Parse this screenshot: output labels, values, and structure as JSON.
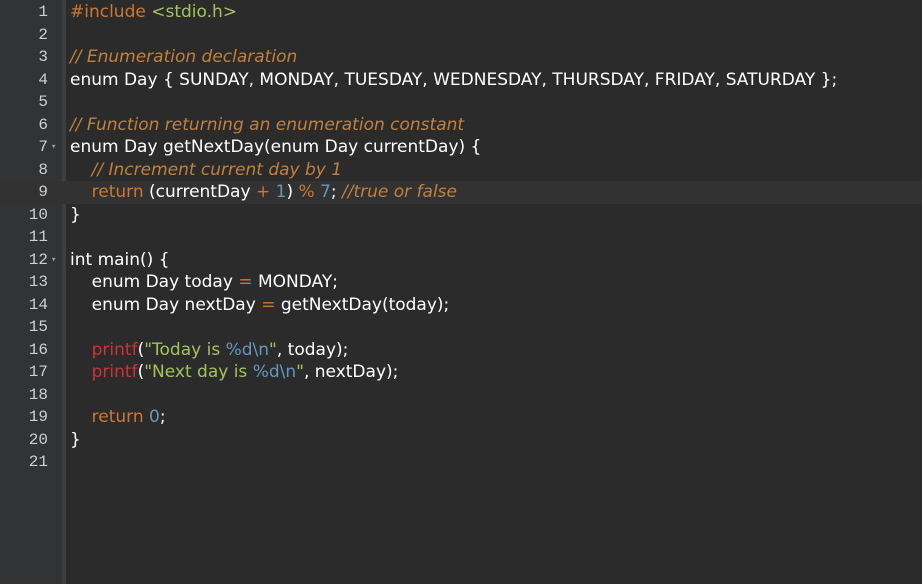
{
  "editor": {
    "language": "c",
    "active_line": 9,
    "colors": {
      "background": "#2b2b2b",
      "gutter": "#313335",
      "keyword": "#cc7832",
      "string": "#a5c25c",
      "comment": "#c0813f",
      "number": "#6897bb",
      "function_call": "#cc3333"
    },
    "line_numbers": [
      "1",
      "2",
      "3",
      "4",
      "5",
      "6",
      "7",
      "8",
      "9",
      "10",
      "11",
      "12",
      "13",
      "14",
      "15",
      "16",
      "17",
      "18",
      "19",
      "20",
      "21"
    ],
    "lines": [
      [
        {
          "t": "#include ",
          "c": "pp"
        },
        {
          "t": "<stdio.h>",
          "c": "inc"
        }
      ],
      [],
      [
        {
          "t": "// Enumeration declaration",
          "c": "cm"
        }
      ],
      [
        {
          "t": "enum Day { SUNDAY, MONDAY, TUESDAY, WEDNESDAY, THURSDAY, FRIDAY, SATURDAY };",
          "c": "pl"
        }
      ],
      [],
      [
        {
          "t": "// Function returning an enumeration constant",
          "c": "cm"
        }
      ],
      [
        {
          "t": "enum Day getNextDay(enum Day currentDay) {",
          "c": "pl"
        }
      ],
      [
        {
          "t": "    ",
          "c": "pl"
        },
        {
          "t": "// Increment current day by 1",
          "c": "cm"
        }
      ],
      [
        {
          "t": "    ",
          "c": "pl"
        },
        {
          "t": "return",
          "c": "ret"
        },
        {
          "t": " (currentDay ",
          "c": "pl"
        },
        {
          "t": "+",
          "c": "op"
        },
        {
          "t": " ",
          "c": "pl"
        },
        {
          "t": "1",
          "c": "num"
        },
        {
          "t": ") ",
          "c": "pl"
        },
        {
          "t": "%",
          "c": "op"
        },
        {
          "t": " ",
          "c": "pl"
        },
        {
          "t": "7",
          "c": "num"
        },
        {
          "t": "; ",
          "c": "pl"
        },
        {
          "t": "//true or false",
          "c": "cm"
        }
      ],
      [
        {
          "t": "}",
          "c": "pl"
        }
      ],
      [],
      [
        {
          "t": "int main() {",
          "c": "pl"
        }
      ],
      [
        {
          "t": "    enum Day today ",
          "c": "pl"
        },
        {
          "t": "=",
          "c": "op"
        },
        {
          "t": " MONDAY;",
          "c": "pl"
        }
      ],
      [
        {
          "t": "    enum Day nextDay ",
          "c": "pl"
        },
        {
          "t": "=",
          "c": "op"
        },
        {
          "t": " getNextDay(today);",
          "c": "pl"
        }
      ],
      [],
      [
        {
          "t": "    ",
          "c": "pl"
        },
        {
          "t": "printf",
          "c": "fn"
        },
        {
          "t": "(",
          "c": "pl"
        },
        {
          "t": "\"Today is ",
          "c": "str"
        },
        {
          "t": "%d\\n",
          "c": "esc"
        },
        {
          "t": "\"",
          "c": "str"
        },
        {
          "t": ", today);",
          "c": "pl"
        }
      ],
      [
        {
          "t": "    ",
          "c": "pl"
        },
        {
          "t": "printf",
          "c": "fn"
        },
        {
          "t": "(",
          "c": "pl"
        },
        {
          "t": "\"Next day is ",
          "c": "str"
        },
        {
          "t": "%d\\n",
          "c": "esc"
        },
        {
          "t": "\"",
          "c": "str"
        },
        {
          "t": ", nextDay);",
          "c": "pl"
        }
      ],
      [],
      [
        {
          "t": "    ",
          "c": "pl"
        },
        {
          "t": "return",
          "c": "ret"
        },
        {
          "t": " ",
          "c": "pl"
        },
        {
          "t": "0",
          "c": "num"
        },
        {
          "t": ";",
          "c": "pl"
        }
      ],
      [
        {
          "t": "}",
          "c": "pl"
        }
      ],
      []
    ],
    "fold_lines": [
      7,
      12
    ]
  }
}
